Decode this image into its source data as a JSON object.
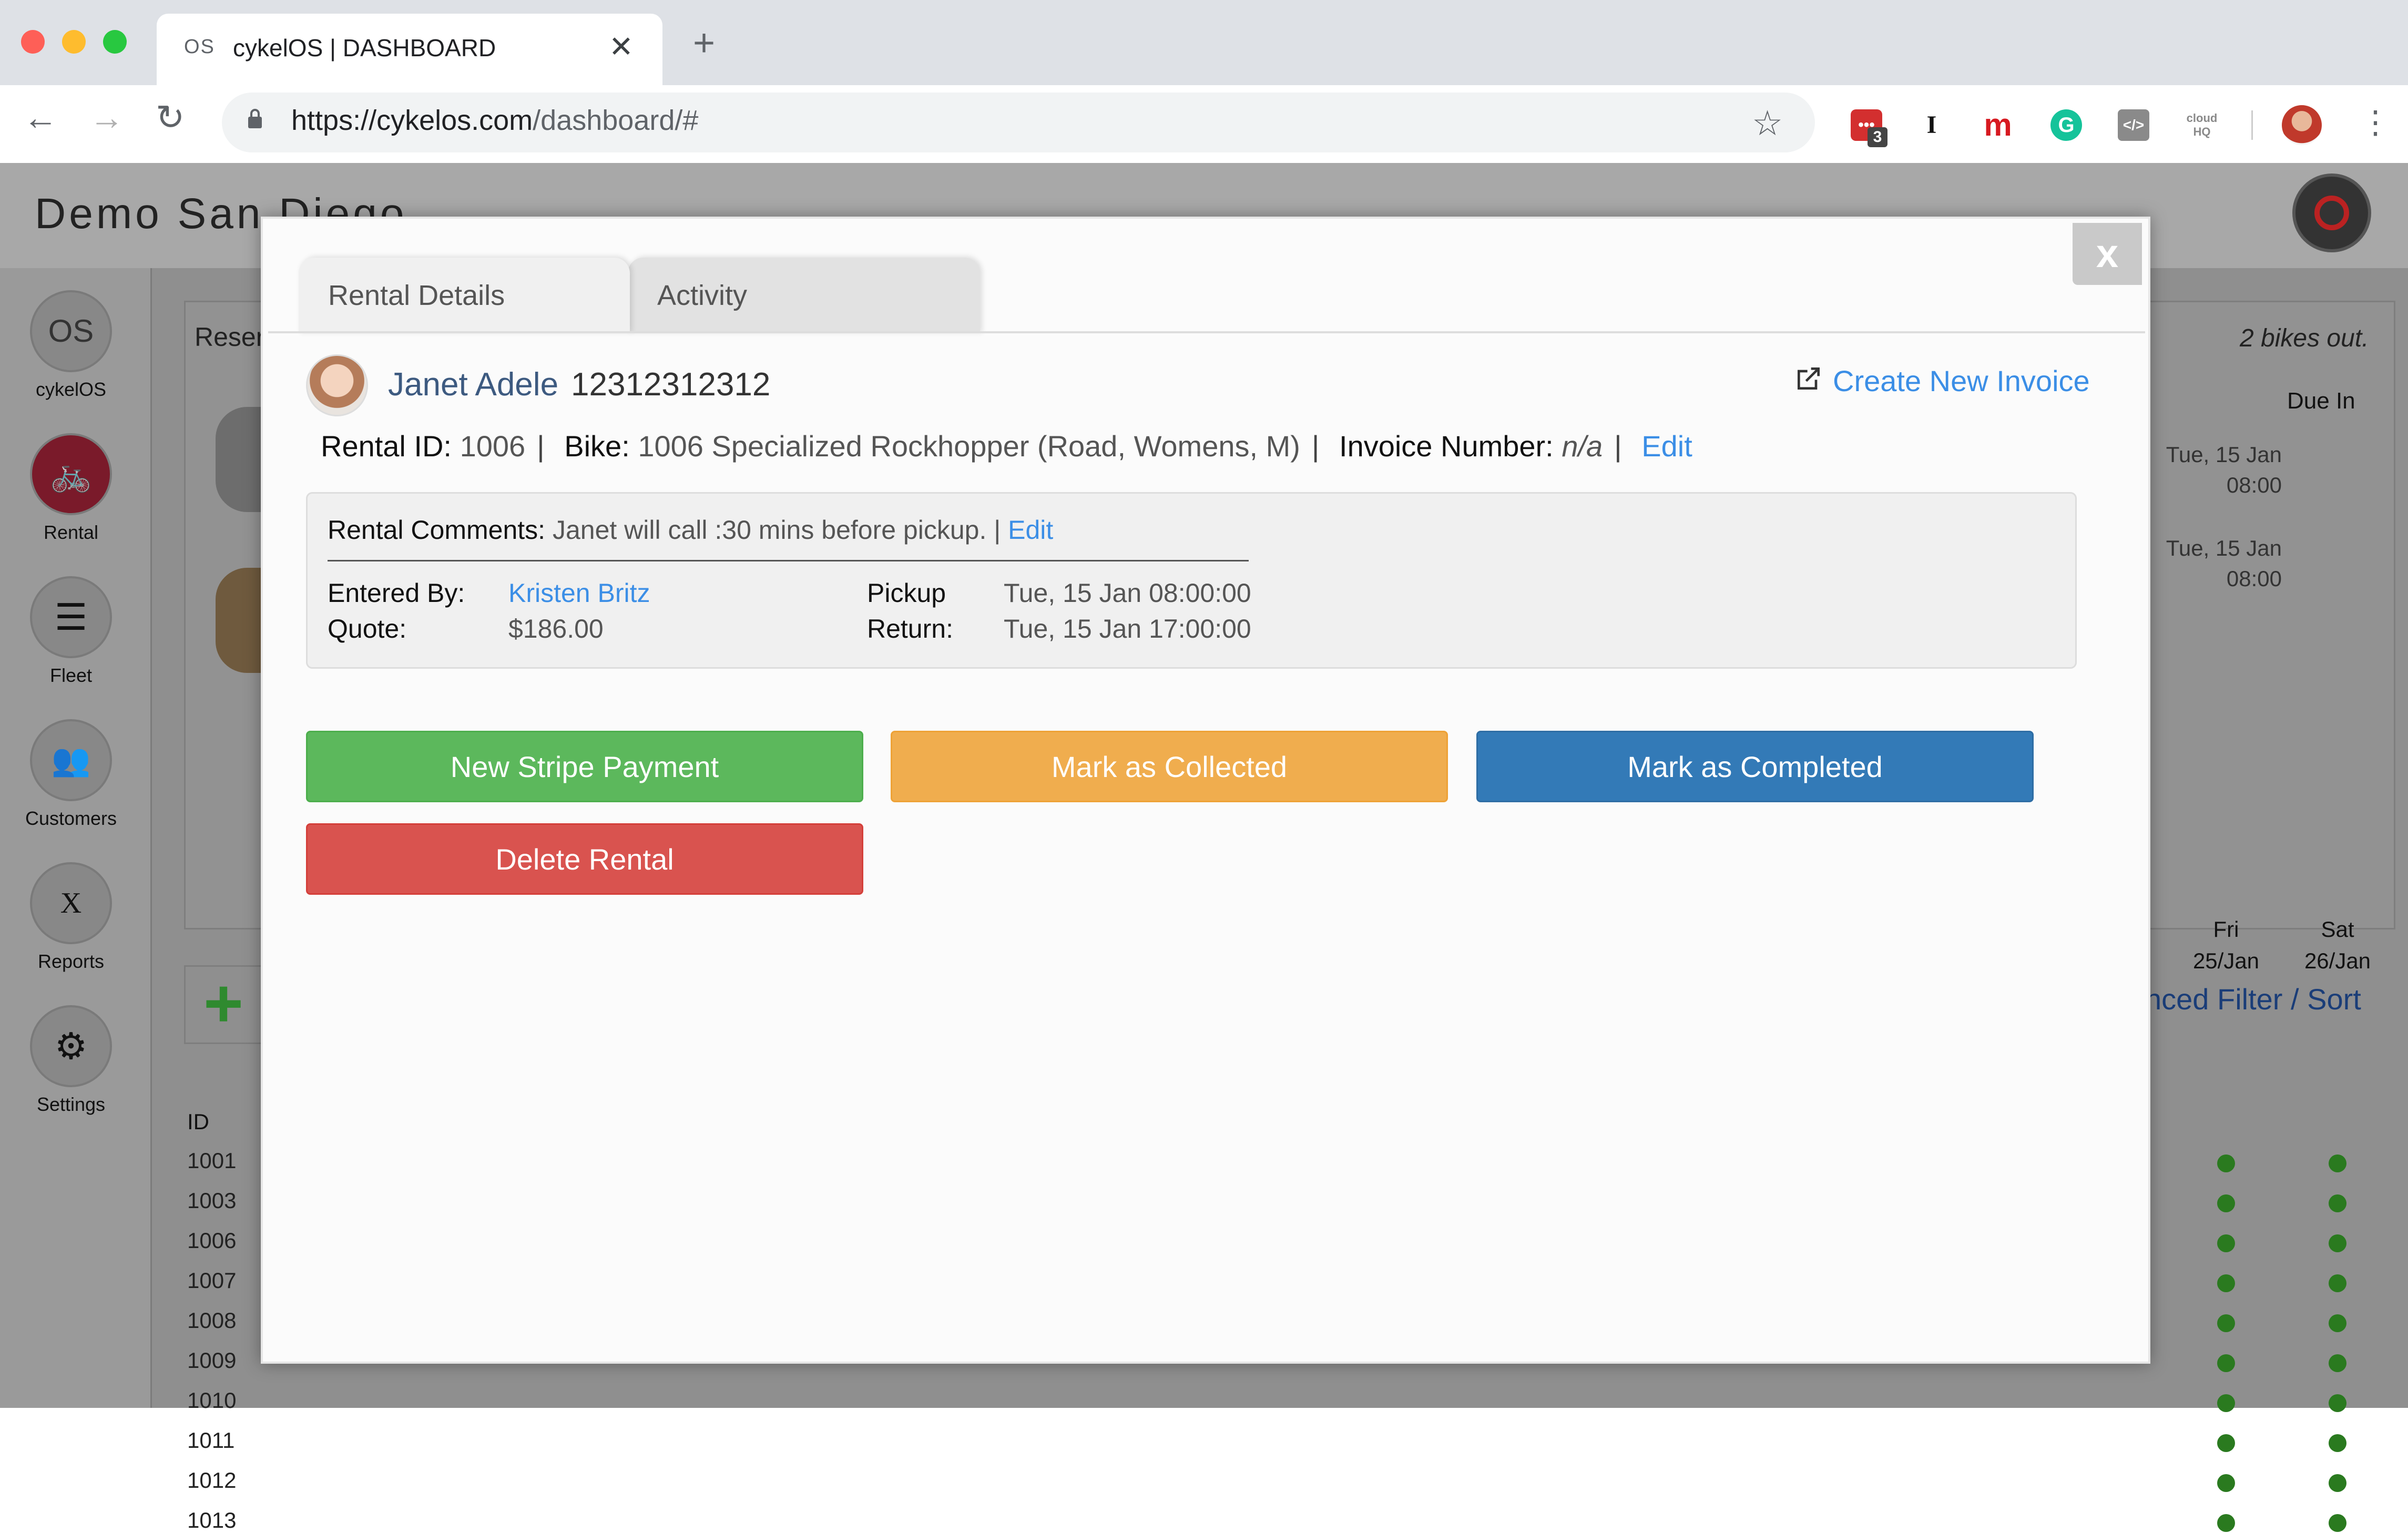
{
  "browser": {
    "tab_favicon": "OS",
    "tab_title": "cykelOS | DASHBOARD",
    "tab_close": "✕",
    "new_tab": "+",
    "back": "←",
    "forward": "→",
    "reload": "↻",
    "url_host": "https://cykelos.com",
    "url_path": "/dashboard/#",
    "bookmark_star": "☆",
    "extensions": [
      {
        "name": "lastpass-icon",
        "glyph": "•••",
        "badge": "3",
        "color": "#d32f2f"
      },
      {
        "name": "instapaper-icon",
        "glyph": "I",
        "color": "#111111"
      },
      {
        "name": "mendeley-icon",
        "glyph": "m",
        "color": "#d71920"
      },
      {
        "name": "grammarly-icon",
        "glyph": "G",
        "color": "#15c39a"
      },
      {
        "name": "code-icon",
        "glyph": "</>",
        "color": "#8a8a8a"
      },
      {
        "name": "cloudhq-icon",
        "glyph": "cloud HQ",
        "color": "#8a8a8a"
      }
    ],
    "menu": "⋮"
  },
  "app": {
    "site_title": "Demo San Diego",
    "sidebar": [
      {
        "label": "cykelOS",
        "glyph": "OS"
      },
      {
        "label": "Rental",
        "glyph": "🚲"
      },
      {
        "label": "Fleet",
        "glyph": "☰"
      },
      {
        "label": "Customers",
        "glyph": "👥"
      },
      {
        "label": "Reports",
        "glyph": "X"
      },
      {
        "label": "Settings",
        "glyph": "⚙"
      }
    ],
    "panel_title": "Reser",
    "bikes_out": "2 bikes out.",
    "due_in_header": "Due In",
    "due_in": [
      {
        "date": "Tue, 15 Jan",
        "time": "08:00"
      },
      {
        "date": "Tue, 15 Jan",
        "time": "08:00"
      }
    ],
    "add_button": "+",
    "filter_link": "nced Filter / Sort",
    "table": {
      "id_header": "ID",
      "ids": [
        "1001",
        "1003",
        "1006",
        "1007",
        "1008",
        "1009",
        "1010",
        "1011",
        "1012",
        "1013"
      ],
      "days": [
        {
          "day": "Fri",
          "date": "25/Jan"
        },
        {
          "day": "Sat",
          "date": "26/Jan"
        }
      ]
    }
  },
  "modal": {
    "close_label": "x",
    "tabs": [
      "Rental Details",
      "Activity"
    ],
    "customer": {
      "name": "Janet Adele",
      "phone": "12312312312"
    },
    "create_invoice": "Create New Invoice",
    "rental_id_label": "Rental ID:",
    "rental_id": "1006",
    "bike_label": "Bike:",
    "bike": "1006 Specialized Rockhopper (Road, Womens, M)",
    "invoice_label": "Invoice Number:",
    "invoice_number": "n/a",
    "edit_label": "Edit",
    "comments": {
      "label": "Rental Comments:",
      "text": "Janet will call :30 mins before pickup. |",
      "edit": "Edit"
    },
    "details": {
      "entered_by_label": "Entered By:",
      "entered_by": "Kristen Britz",
      "quote_label": "Quote:",
      "quote": "$186.00",
      "pickup_label": "Pickup",
      "pickup": "Tue, 15 Jan 08:00:00",
      "return_label": "Return:",
      "return": "Tue, 15 Jan 17:00:00"
    },
    "buttons": {
      "stripe": "New Stripe Payment",
      "collected": "Mark as Collected",
      "completed": "Mark as Completed",
      "delete": "Delete Rental"
    }
  },
  "colors": {
    "success": "#5cb85c",
    "warning": "#f0ad4e",
    "primary": "#337ab7",
    "danger": "#d9534f",
    "link": "#3b8ee6"
  }
}
